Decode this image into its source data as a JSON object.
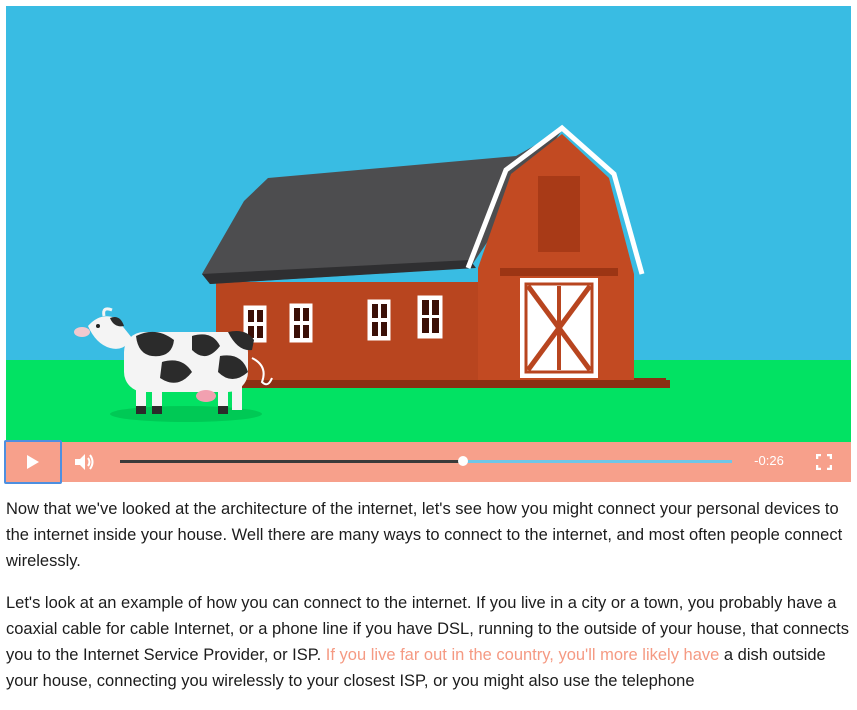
{
  "video": {
    "scene_icon": "barn-and-cow-illustration",
    "colors": {
      "sky": "#39bce3",
      "grass": "#02e263",
      "barn": "#b8451f",
      "roof": "#4d4d4f",
      "controls_bg": "#f7a08b",
      "progress_track": "#6ec6e8",
      "highlight_text": "#f59a83",
      "focus_ring": "#4d8fe0"
    }
  },
  "controls": {
    "play_icon": "play-icon",
    "volume_icon": "volume-icon",
    "fullscreen_icon": "fullscreen-icon",
    "progress_fraction": 0.56,
    "time_remaining": "-0:26"
  },
  "article": {
    "p1": "Now that we've looked at the architecture of the internet, let's see how you might connect your personal devices to the internet inside your house. Well there are many ways to connect to the internet, and most often people connect wirelessly.",
    "p2_start": "Let's look at an example of how you can connect to the internet. If you live in a city or a town, you probably have a coaxial cable for cable Internet, or a phone line if you have DSL, running to the outside of your house, that connects you to the Internet Service Provider, or ISP. ",
    "p2_highlight": "If you live far out in the country, you'll more likely have",
    "p2_end": " a dish outside your house, connecting you wirelessly to your closest ISP, or you might also use the telephone"
  }
}
